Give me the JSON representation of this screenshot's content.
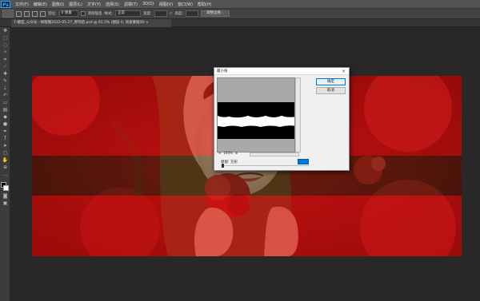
{
  "app": {
    "logo": "Ps"
  },
  "menu": [
    "文件(F)",
    "编辑(E)",
    "图像(I)",
    "图层(L)",
    "文字(Y)",
    "选择(S)",
    "滤镜(T)",
    "3D(D)",
    "视图(V)",
    "窗口(W)",
    "帮助(H)"
  ],
  "options": {
    "feather_label": "羽化:",
    "feather_value": "0 像素",
    "antialias_label": "消除锯齿",
    "style_label": "样式:",
    "style_value": "正常",
    "width_label": "宽度:",
    "height_label": "高度:",
    "refine_edge": "调整边缘..."
  },
  "document": {
    "tab_title": "7-模型_公众号 - 样版图2022-05-27_修饰后.psd @ 61.5% (图层 0, 快速蒙版/8) ×"
  },
  "dialog": {
    "title": "最小值",
    "close": "×",
    "ok": "确定",
    "cancel": "取消",
    "zoom_out": "⊟",
    "zoom_level": "100%",
    "zoom_in": "⊞",
    "radius_label": "半径(R):",
    "radius_value": "",
    "keep_label": "保留: 方形"
  },
  "colors": {
    "accent": "#0078d7",
    "image_red": "#c0100f",
    "mask_overlay": "#d01010"
  }
}
